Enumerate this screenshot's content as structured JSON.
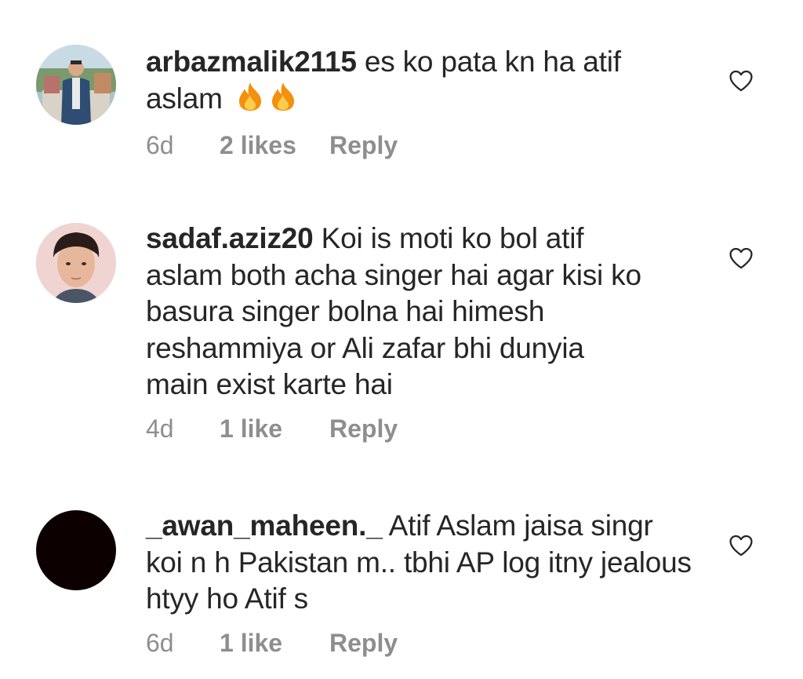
{
  "comments": [
    {
      "username": "arbazmalik2115",
      "text": "es ko pata kn ha atif aslam",
      "emojis": [
        "fire",
        "fire"
      ],
      "time": "6d",
      "likes": "2 likes",
      "reply": "Reply",
      "avatar": "photo"
    },
    {
      "username": "sadaf.aziz20",
      "text": "Koi is moti ko bol atif aslam both acha singer hai agar kisi ko basura singer bolna hai himesh reshammiya or Ali zafar bhi dunyia main exist karte hai",
      "time": "4d",
      "likes": "1 like",
      "reply": "Reply",
      "avatar": "photo"
    },
    {
      "username": "_awan_maheen._",
      "text": "Atif Aslam jaisa singr koi n h Pakistan m.. tbhi AP log itny jealous htyy ho Atif s",
      "time": "6d",
      "likes": "1 like",
      "reply": "Reply",
      "avatar": "black-circle"
    }
  ],
  "icons": {
    "like": "heart-outline-icon",
    "emoji": "fire-emoji-icon"
  },
  "colors": {
    "text": "#262626",
    "secondary": "#8e8e8e",
    "fire_outer": "#f4900c",
    "fire_inner": "#ffcc4d"
  }
}
